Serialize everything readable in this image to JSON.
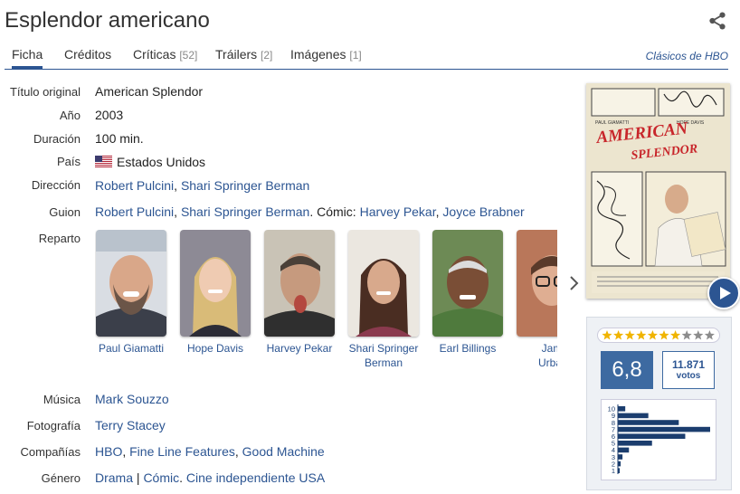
{
  "title": "Esplendor americano",
  "tabs": [
    {
      "label": "Ficha",
      "count": ""
    },
    {
      "label": "Créditos",
      "count": ""
    },
    {
      "label": "Críticas",
      "count": "[52]"
    },
    {
      "label": "Tráilers",
      "count": "[2]"
    },
    {
      "label": "Imágenes",
      "count": "[1]"
    }
  ],
  "collection_link": "Clásicos de HBO",
  "details": {
    "original_title": {
      "label": "Título original",
      "value": "American Splendor"
    },
    "year": {
      "label": "Año",
      "value": "2003"
    },
    "duration": {
      "label": "Duración",
      "value": "100 min."
    },
    "country": {
      "label": "País",
      "value": "Estados Unidos",
      "flag": "us-flag-icon"
    },
    "direction": {
      "label": "Dirección",
      "people": [
        "Robert Pulcini",
        "Shari Springer Berman"
      ]
    },
    "screenplay": {
      "label": "Guion",
      "people": [
        "Robert Pulcini",
        "Shari Springer Berman"
      ],
      "comic_prefix": "Cómic:",
      "comic_people": [
        "Harvey Pekar",
        "Joyce Brabner"
      ]
    },
    "cast": {
      "label": "Reparto",
      "actors": [
        {
          "name": "Paul Giamatti"
        },
        {
          "name": "Hope Davis"
        },
        {
          "name": "Harvey Pekar"
        },
        {
          "name": "Shari Springer",
          "name2": "Berman"
        },
        {
          "name": "Earl Billings"
        },
        {
          "name": "Jam",
          "name2": "Urbar"
        }
      ]
    },
    "music": {
      "label": "Música",
      "people": [
        "Mark Souzzo"
      ]
    },
    "photography": {
      "label": "Fotografía",
      "people": [
        "Terry Stacey"
      ]
    },
    "companies": {
      "label": "Compañías",
      "items": [
        "HBO",
        "Fine Line Features",
        "Good Machine"
      ]
    },
    "genre": {
      "label": "Género",
      "main": "Drama",
      "separator": "|",
      "sub": [
        "Cómic",
        "Cine independiente USA"
      ]
    }
  },
  "poster": {
    "title_line1": "AMERICAN",
    "title_line2": "SPLENDOR",
    "credit_left": "PAUL GIAMATTI",
    "credit_right": "HOPE DAVIS"
  },
  "rating": {
    "average": "6,8",
    "votes_count": "11.871",
    "votes_label": "votos",
    "stars_filled": 7,
    "stars_total": 10,
    "histogram_labels": [
      "10",
      "9",
      "8",
      "7",
      "6",
      "5",
      "4",
      "3",
      "2",
      "1"
    ],
    "histogram_fractions": [
      0.08,
      0.33,
      0.66,
      1.0,
      0.73,
      0.37,
      0.12,
      0.05,
      0.03,
      0.02
    ]
  },
  "icons": {
    "share": "share-icon",
    "next": "chevron-right-icon",
    "play": "play-icon"
  },
  "colors": {
    "link": "#2c5592",
    "rating_bg": "#3d6aa1",
    "star": "#f0b400"
  }
}
